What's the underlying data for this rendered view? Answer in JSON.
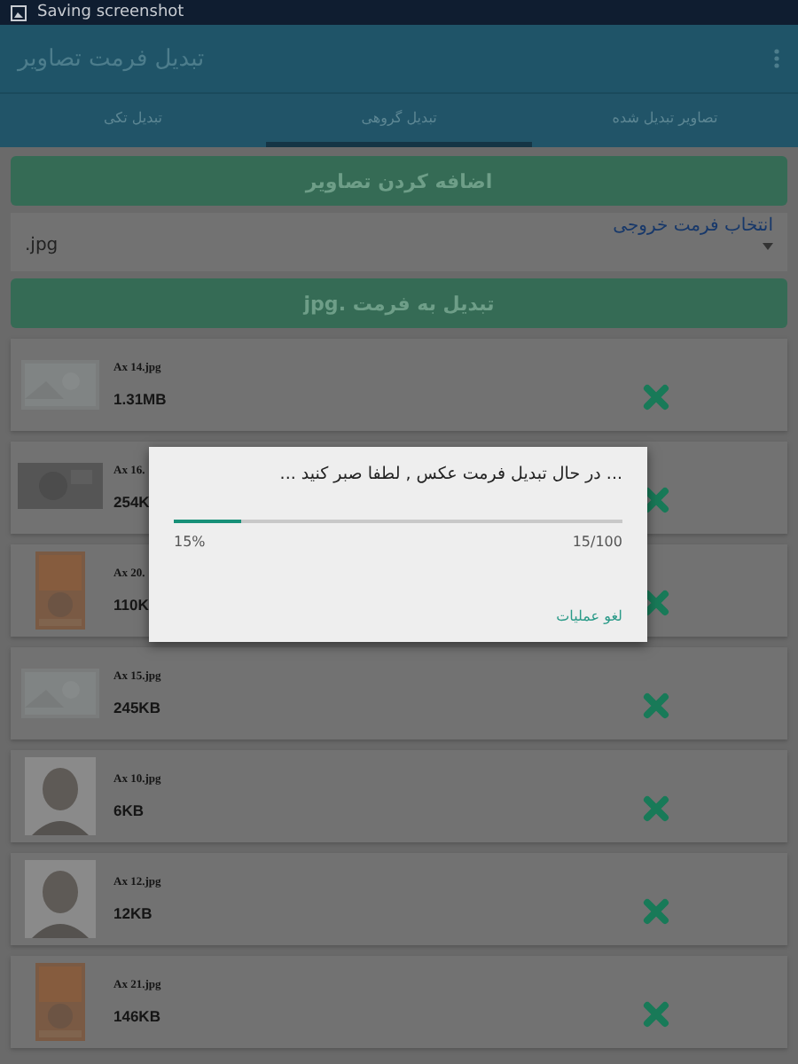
{
  "status_bar": {
    "text": "Saving screenshot"
  },
  "app_bar": {
    "title": "تبدیل فرمت تصاویر"
  },
  "tabs": [
    {
      "label": "تصاویر تبدیل شده",
      "selected": false
    },
    {
      "label": "تبدیل گروهی",
      "selected": true
    },
    {
      "label": "تبدیل تکی",
      "selected": false
    }
  ],
  "add_button": "اضافه کردن تصاویر",
  "format_select": {
    "label": "انتخاب فرمت خروجی",
    "value": ".jpg"
  },
  "convert_button": "تبدیل به فرمت .jpg",
  "files": [
    {
      "name": "Ax 14.jpg",
      "size": "1.31MB"
    },
    {
      "name": "Ax 16.",
      "size": "254K"
    },
    {
      "name": "Ax 20.",
      "size": "110K"
    },
    {
      "name": "Ax 15.jpg",
      "size": "245KB"
    },
    {
      "name": "Ax 10.jpg",
      "size": "6KB"
    },
    {
      "name": "Ax 12.jpg",
      "size": "12KB"
    },
    {
      "name": "Ax 21.jpg",
      "size": "146KB"
    }
  ],
  "dialog": {
    "message": "... در حال تبدیل فرمت عکس , لطفا صبر کنید ...",
    "level": 0.15,
    "percent": "15%",
    "count": "15/100",
    "cancel": "لغو عملیات"
  }
}
